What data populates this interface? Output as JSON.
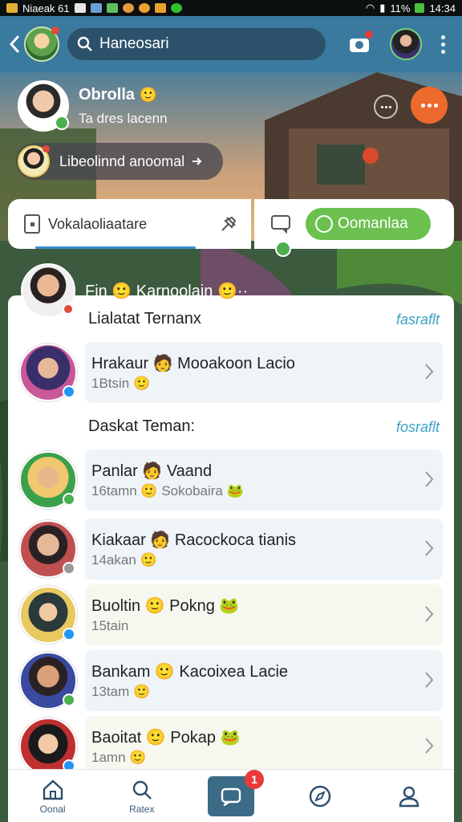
{
  "status_bar": {
    "left_text": "Niaeak 61",
    "battery": "11%",
    "time": "14:34"
  },
  "appbar": {
    "search_text": "Haneosari"
  },
  "profile": {
    "name": "Obrolla",
    "name_emoji": "🙂",
    "subtitle": "Ta dres lacenn"
  },
  "pill": {
    "label": "Libeolinnd anoomal"
  },
  "actions": {
    "left_label": "Vokalaoliaatare",
    "right_button": "Oomanlaa"
  },
  "friend_banner": {
    "text": "Fin 🙂 Karnoolain 🙂··"
  },
  "sections": [
    {
      "title": "Lialatat Ternanx",
      "link": "fasraflt",
      "items": [
        {
          "line1": "Hrakaur 🧑 Mooakoon Lacio",
          "line2": "1Btsin 🙂",
          "badge_color": "#2196f3",
          "avatar_colors": [
            "#6a3a2a",
            "#3a2f6b",
            "#c8589a"
          ]
        }
      ]
    },
    {
      "title": "Daskat Teman:",
      "link": "fosraflt",
      "items": [
        {
          "line1": "Panlar 🧑 Vaand",
          "line2": "16tamn 🙂 Sokobaira 🐸",
          "badge_color": "#4caf50",
          "avatar_colors": [
            "#f0c870",
            "#7a4a2a",
            "#3aa04a"
          ]
        },
        {
          "line1": "Kiakaar 🧑 Racockoca tianis",
          "line2": "14akan 🙂",
          "badge_color": "#999999",
          "avatar_colors": [
            "#e5b898",
            "#2a2222",
            "#c05050"
          ]
        },
        {
          "line1": "Buoltin 🙂 Pokng 🐸",
          "line2": "15tain",
          "badge_color": "#2196f3",
          "avatar_colors": [
            "#f0c9a5",
            "#2a3a3a",
            "#e8c860"
          ]
        },
        {
          "line1": "Bankam 🙂 Kacoixea Lacie",
          "line2": "13tam 🙂",
          "badge_color": "#4caf50",
          "avatar_colors": [
            "#d9a07a",
            "#2a2222",
            "#3a4aa0"
          ]
        },
        {
          "line1": "Baoitat 🙂 Pokap 🐸",
          "line2": "1amn 🙂",
          "badge_color": "#2196f3",
          "avatar_colors": [
            "#f0c9a5",
            "#1a1a1a",
            "#c03030"
          ]
        }
      ]
    }
  ],
  "bottom_nav": [
    {
      "label": "Oonal",
      "icon": "home-icon"
    },
    {
      "label": "Ratex",
      "icon": "search-icon"
    },
    {
      "label": "",
      "icon": "chat-icon",
      "badge": "1"
    },
    {
      "label": "",
      "icon": "compass-icon"
    },
    {
      "label": "",
      "icon": "profile-icon"
    }
  ]
}
